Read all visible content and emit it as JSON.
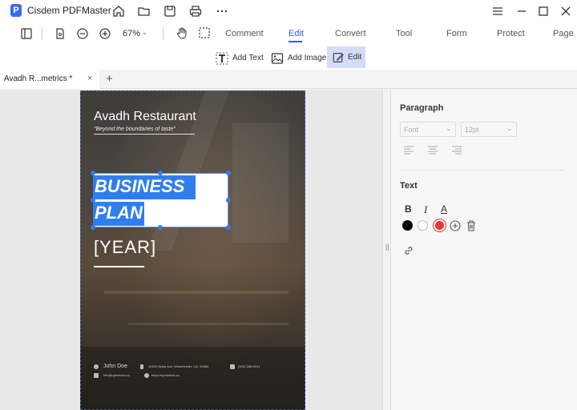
{
  "app": {
    "title": "Cisdem PDFMaster",
    "logo_letter": "P"
  },
  "toolbar": {
    "zoom": "67%",
    "tabs": [
      "Comment",
      "Edit",
      "Convert",
      "Tool",
      "Form",
      "Protect",
      "Page"
    ],
    "active_tab": "Edit"
  },
  "subtoolbar": {
    "add_text": "Add Text",
    "add_image": "Add Image",
    "edit": "Edit"
  },
  "document_tab": {
    "label": "Avadh R...metrics *",
    "close": "×",
    "new_tab": "+"
  },
  "page": {
    "restaurant_name": "Avadh Restaurant",
    "tagline": "\"Beyond the boundaries of taste\"",
    "heading_line1": "BUSINESS",
    "heading_line2": "PLAN",
    "year": "[YEAR]",
    "contact_name": "John Doe",
    "contact_address": "10200 Bolsa Ave, Westminster, CA, 92683",
    "contact_phone": "(000) 356-5151",
    "contact_email": "info@upmetrics.co",
    "contact_web": "https://upmetrics.co"
  },
  "panel": {
    "paragraph_title": "Paragraph",
    "font_placeholder": "Font",
    "size_placeholder": "12pt",
    "text_title": "Text",
    "bold": "B",
    "italic": "I",
    "underline_a": "A",
    "colors": [
      "#000000",
      "#ffffff",
      "#e53935"
    ],
    "selected_color": "#e53935"
  },
  "colors": {
    "accent": "#2f5fd8",
    "highlight": "#2f7ef0"
  }
}
